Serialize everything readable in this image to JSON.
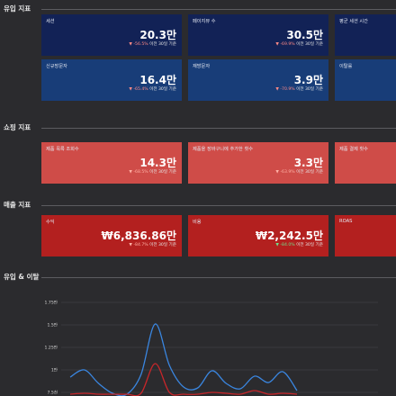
{
  "sections": {
    "inflow": "유입 지표",
    "shopping": "쇼핑 지표",
    "sales": "매출 지표",
    "inflow_exit": "유입 & 이탈"
  },
  "inflow_cards": [
    {
      "label": "세션",
      "value": "20.3만",
      "change": "-56.5%",
      "period": "이전 30일 기준"
    },
    {
      "label": "페이지뷰 수",
      "value": "30.5만",
      "change": "-69.9%",
      "period": "이전 30일 기준"
    },
    {
      "label": "평균 세션 시간"
    },
    {
      "label": "신규방문자",
      "value": "16.4만",
      "change": "-65.4%",
      "period": "이전 30일 기준"
    },
    {
      "label": "재방문자",
      "value": "3.9만",
      "change": "-70.9%",
      "period": "이전 30일 기준"
    },
    {
      "label": "이탈률"
    }
  ],
  "shopping_cards": [
    {
      "label": "제품 목록 조회수",
      "value": "14.3만",
      "change": "-68.5%",
      "period": "이전 30일 기준"
    },
    {
      "label": "제품을 장바구니에 추가한 횟수",
      "value": "3.3만",
      "change": "-63.9%",
      "period": "이전 30일 기준"
    },
    {
      "label": "제품 결제 횟수"
    }
  ],
  "sales_cards": [
    {
      "label": "수익",
      "value": "₩6,836.86만",
      "change": "-84.7%",
      "period": "이전 30일 기준"
    },
    {
      "label": "비용",
      "value": "₩2,242.5만",
      "change": "-84.0%",
      "period": "이전 30일 기준"
    },
    {
      "label": "ROAS"
    }
  ],
  "chart_data": {
    "type": "line",
    "y_ticks": [
      "1.75만",
      "1.5만",
      "1.25만",
      "1만",
      "7.5천"
    ],
    "ylim": [
      7500,
      17500
    ],
    "series": [
      {
        "color": "#3a86e0",
        "values": [
          9200,
          10000,
          8500,
          7400,
          7300,
          9500,
          15100,
          10500,
          8100,
          8000,
          9900,
          8500,
          7900,
          9300,
          8600,
          9800,
          7700
        ]
      },
      {
        "color": "#c8262a",
        "values": [
          7300,
          7400,
          7300,
          7300,
          7300,
          7400,
          10700,
          7500,
          7300,
          7300,
          7500,
          7400,
          7300,
          7700,
          7300,
          7400,
          7300
        ]
      }
    ],
    "colors": {
      "grid": "#4a4a4e"
    }
  }
}
